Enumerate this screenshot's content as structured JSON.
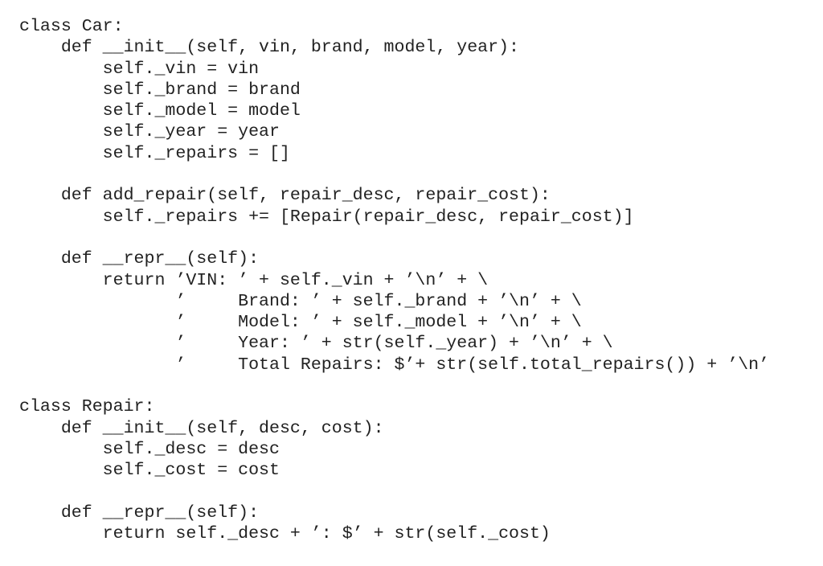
{
  "document": {
    "type": "python-source-listing",
    "lines": [
      "class Car:",
      "    def __init__(self, vin, brand, model, year):",
      "        self._vin = vin",
      "        self._brand = brand",
      "        self._model = model",
      "        self._year = year",
      "        self._repairs = []",
      "",
      "    def add_repair(self, repair_desc, repair_cost):",
      "        self._repairs += [Repair(repair_desc, repair_cost)]",
      "",
      "    def __repr__(self):",
      "        return ’VIN: ’ + self._vin + ’\\n’ + \\",
      "               ’     Brand: ’ + self._brand + ’\\n’ + \\",
      "               ’     Model: ’ + self._model + ’\\n’ + \\",
      "               ’     Year: ’ + str(self._year) + ’\\n’ + \\",
      "               ’     Total Repairs: $’+ str(self.total_repairs()) + ’\\n’",
      "",
      "class Repair:",
      "    def __init__(self, desc, cost):",
      "        self._desc = desc",
      "        self._cost = cost",
      "",
      "    def __repr__(self):",
      "        return self._desc + ’: $’ + str(self._cost)"
    ]
  }
}
